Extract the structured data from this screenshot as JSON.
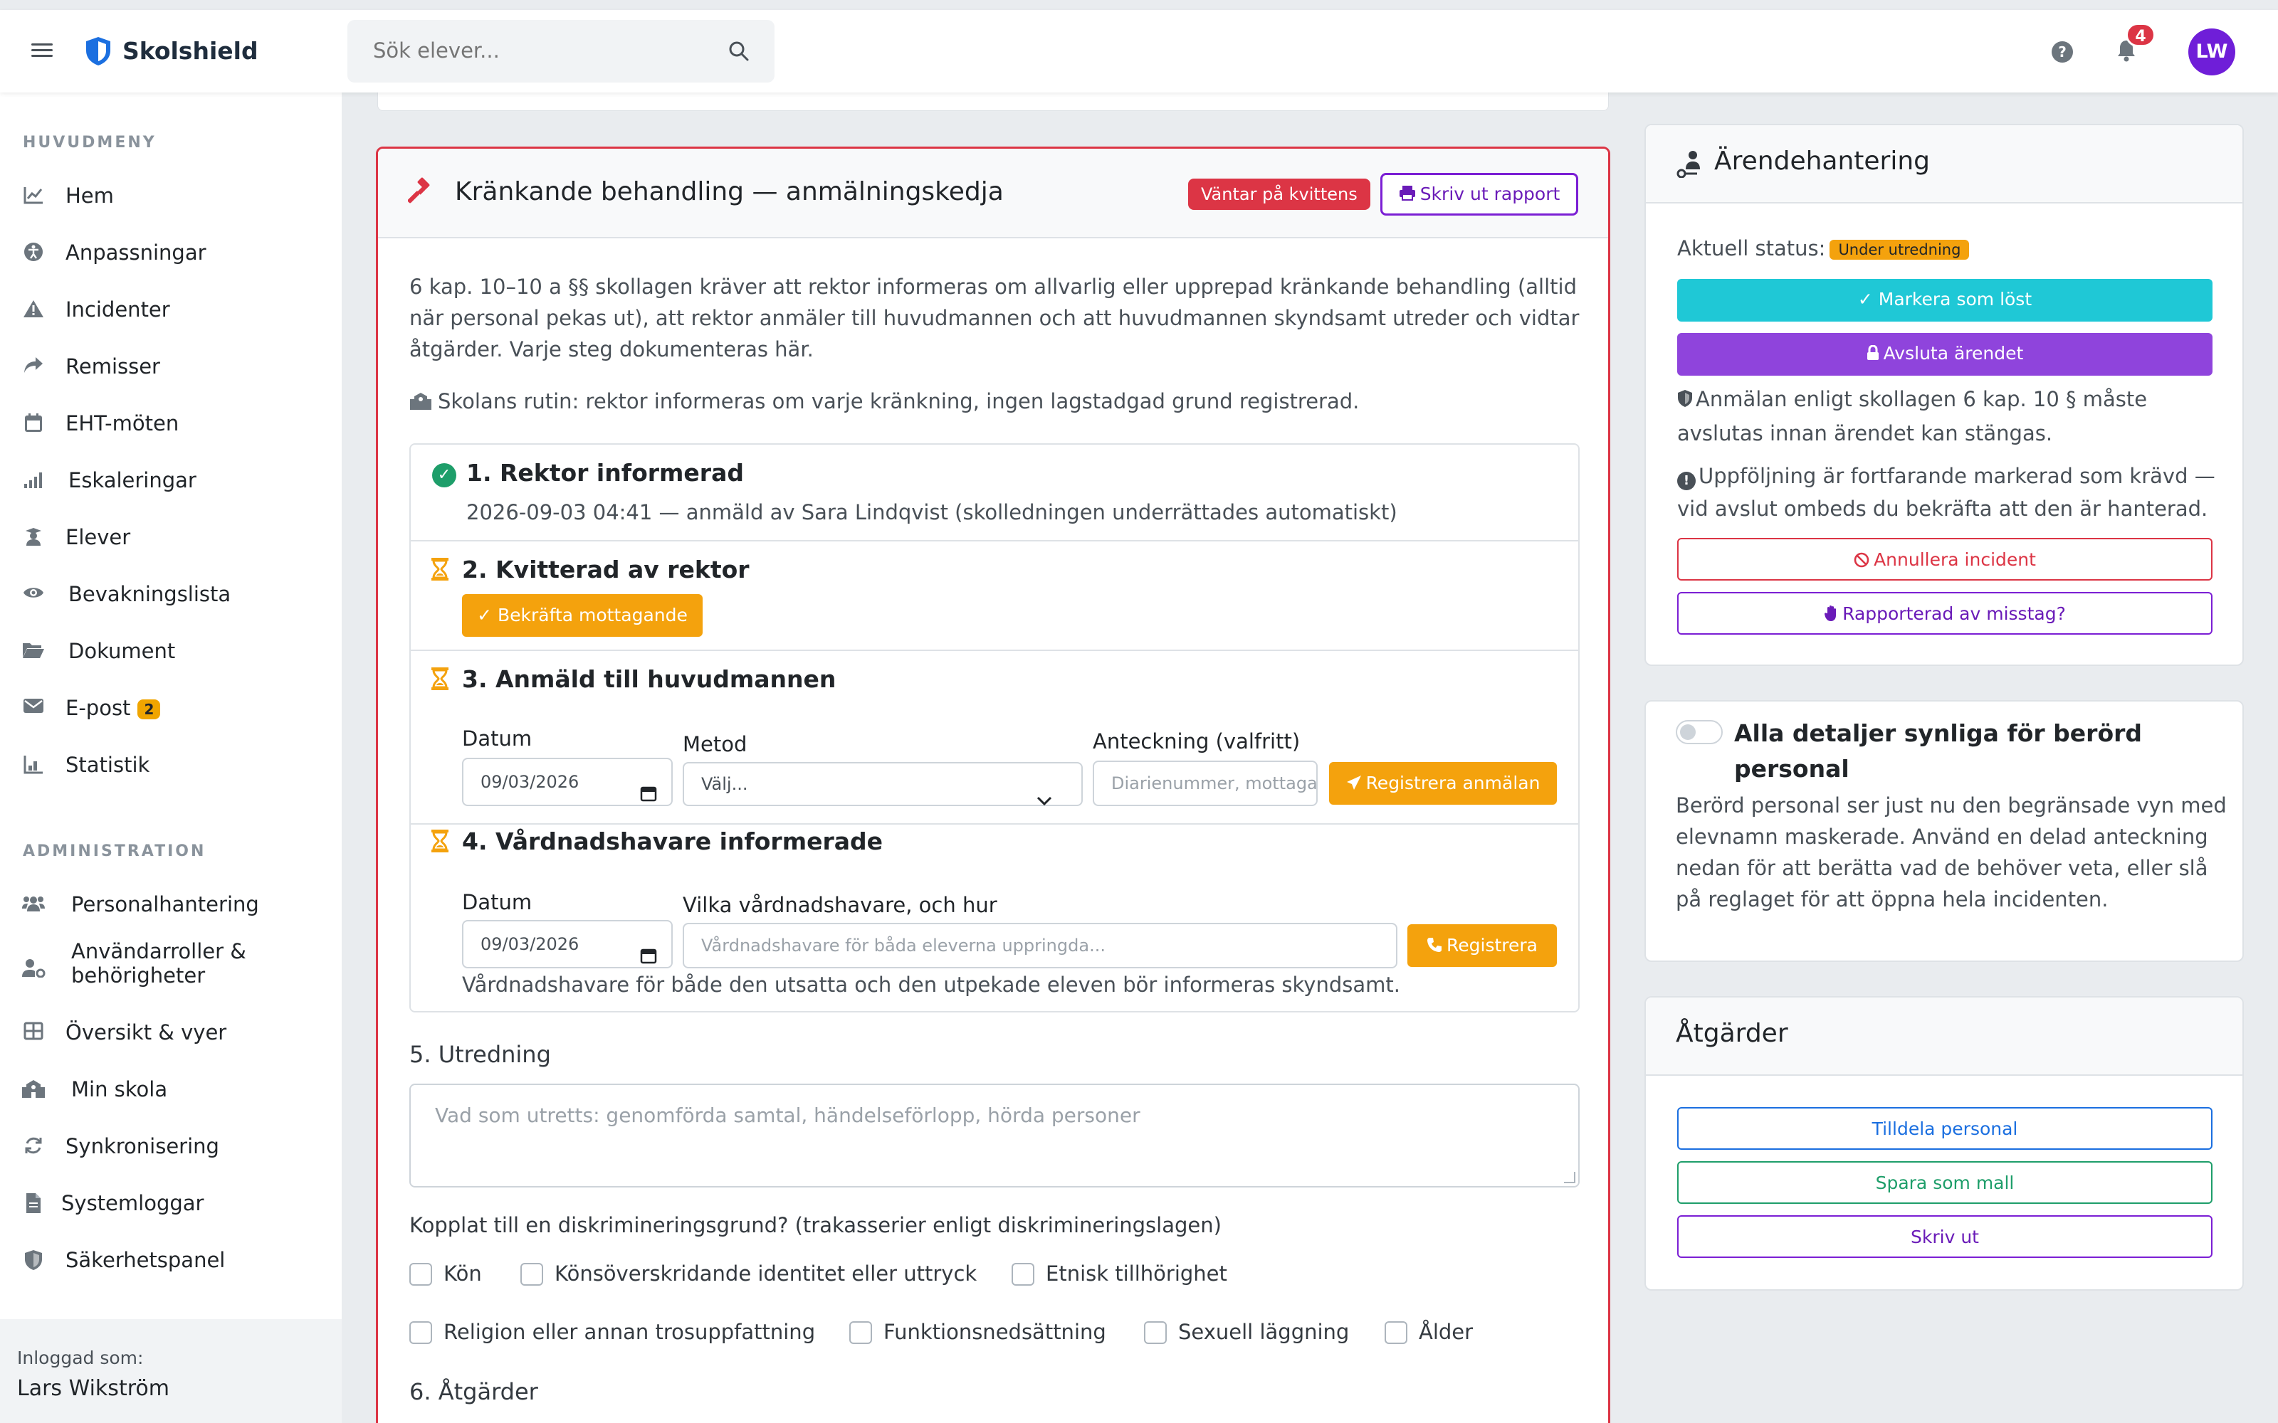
{
  "app": {
    "name": "Skolshield"
  },
  "search": {
    "placeholder": "Sök elever..."
  },
  "topbar": {
    "notif_count": "4",
    "avatar": "LW"
  },
  "sidebar": {
    "main_heading": "HUVUDMENY",
    "main_items": [
      {
        "label": "Hem",
        "icon": "chart-line-icon"
      },
      {
        "label": "Anpassningar",
        "icon": "universal-access-icon"
      },
      {
        "label": "Incidenter",
        "icon": "warning-icon"
      },
      {
        "label": "Remisser",
        "icon": "share-icon"
      },
      {
        "label": "EHT-möten",
        "icon": "calendar-icon"
      },
      {
        "label": "Eskaleringar",
        "icon": "escalation-icon"
      },
      {
        "label": "Elever",
        "icon": "student-icon"
      },
      {
        "label": "Bevakningslista",
        "icon": "eye-icon"
      },
      {
        "label": "Dokument",
        "icon": "folder-icon"
      },
      {
        "label": "E-post",
        "icon": "envelope-icon",
        "badge": "2"
      },
      {
        "label": "Statistik",
        "icon": "chart-bar-icon"
      }
    ],
    "admin_heading": "ADMINISTRATION",
    "admin_items": [
      {
        "label": "Personalhantering",
        "icon": "users-icon"
      },
      {
        "label": "Användarroller & behörigheter",
        "icon": "user-gear-icon"
      },
      {
        "label": "Översikt & vyer",
        "icon": "table-icon"
      },
      {
        "label": "Min skola",
        "icon": "school-icon"
      },
      {
        "label": "Synkronisering",
        "icon": "sync-icon"
      },
      {
        "label": "Systemloggar",
        "icon": "file-icon"
      },
      {
        "label": "Säkerhetspanel",
        "icon": "shield-icon"
      }
    ],
    "logged_in_label": "Inloggad som:",
    "logged_in_user": "Lars Wikström"
  },
  "main": {
    "title": "Kränkande behandling — anmälningskedja",
    "pending_badge": "Väntar på kvittens",
    "print_button": "Skriv ut rapport",
    "intro": "6 kap. 10–10 a §§ skollagen kräver att rektor informeras om allvarlig eller upprepad kränkande behandling (alltid när personal pekas ut), att rektor anmäler till huvudmannen och att huvudmannen skyndsamt utreder och vidtar åtgärder. Varje steg dokumenteras här.",
    "routine": "Skolans rutin: rektor informeras om varje kränkning, ingen lagstadgad grund registrerad.",
    "steps": {
      "s1_title": "1. Rektor informerad",
      "s1_detail": "2026-09-03 04:41 — anmäld av Sara Lindqvist (skolledningen underrättades automatiskt)",
      "s2_title": "2. Kvitterad av rektor",
      "s2_button": "Bekräfta mottagande",
      "s3_title": "3. Anmäld till huvudmannen",
      "s3_date_label": "Datum",
      "s3_date_value": "09/03/2026",
      "s3_method_label": "Metod",
      "s3_method_value": "Välj...",
      "s3_note_label": "Anteckning (valfritt)",
      "s3_note_placeholder": "Diarienummer, mottagare",
      "s3_button": "Registrera anmälan",
      "s4_title": "4. Vårdnadshavare informerade",
      "s4_date_label": "Datum",
      "s4_date_value": "09/03/2026",
      "s4_who_label": "Vilka vårdnadshavare, och hur",
      "s4_who_placeholder": "Vårdnadshavare för båda eleverna uppringda...",
      "s4_button": "Registrera",
      "s4_note": "Vårdnadshavare för både den utsatta och den utpekade eleven bör informeras skyndsamt."
    },
    "s5_title": "5. Utredning",
    "s5_placeholder": "Vad som utretts: genomförda samtal, händelseförlopp, hörda personer",
    "disc_question": "Kopplat till en diskrimineringsgrund? (trakasserier enligt diskrimineringslagen)",
    "disc_options": [
      "Kön",
      "Könsöverskridande identitet eller uttryck",
      "Etnisk tillhörighet",
      "Religion eller annan trosuppfattning",
      "Funktionsnedsättning",
      "Sexuell läggning",
      "Ålder"
    ],
    "s6_title": "6. Åtgärder"
  },
  "case_panel": {
    "title": "Ärendehantering",
    "status_label": "Aktuell status:",
    "status_value": "Under utredning",
    "mark_resolved": "Markera som löst",
    "close_case": "Avsluta ärendet",
    "note1": "Anmälan enligt skollagen 6 kap. 10 § måste avslutas innan ärendet kan stängas.",
    "note2": "Uppföljning är fortfarande markerad som krävd — vid avslut ombeds du bekräfta att den är hanterad.",
    "cancel_incident": "Annullera incident",
    "reported_by_mistake": "Rapporterad av misstag?"
  },
  "visibility_panel": {
    "toggle_label": "Alla detaljer synliga för berörd personal",
    "toggle_on": false,
    "description": "Berörd personal ser just nu den begränsade vyn med elevnamn maskerade. Använd en delad anteckning nedan för att berätta vad de behöver veta, eller slå på reglaget för att öppna hela incidenten."
  },
  "actions_panel": {
    "title": "Åtgärder",
    "assign_staff": "Tilldela personal",
    "save_template": "Spara som mall",
    "print": "Skriv ut"
  },
  "colors": {
    "danger": "#dc3545",
    "warning": "#f4a20d",
    "purple": "#7b1fd4",
    "teal": "#1fc8d6",
    "success": "#1e9e6a"
  }
}
